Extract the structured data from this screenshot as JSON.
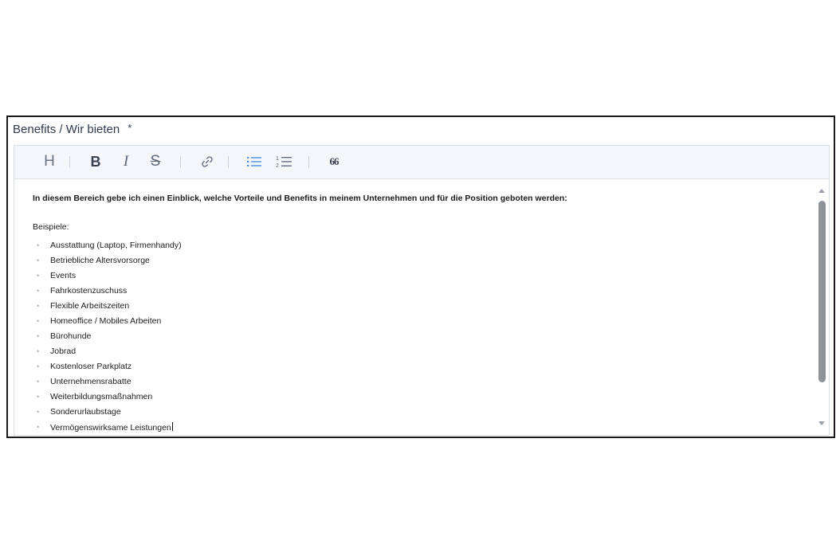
{
  "field": {
    "label": "Benefits / Wir bieten",
    "required_marker": "*"
  },
  "toolbar": {
    "heading": "H",
    "bold": "B",
    "italic": "I",
    "strikethrough": "S",
    "quote": "66",
    "icons": [
      "heading-icon",
      "bold-icon",
      "italic-icon",
      "strikethrough-icon",
      "link-icon",
      "bullet-list-icon",
      "numbered-list-icon",
      "quote-icon"
    ],
    "accent_color": "#4a8fe7"
  },
  "content": {
    "intro": "In diesem Bereich gebe ich einen Einblick, welche Vorteile und Benefits in meinem Unternehmen und für die Position geboten werden:",
    "examples_label": "Beispiele:",
    "items": [
      "Ausstattung (Laptop, Firmenhandy)",
      "Betriebliche Altersvorsorge",
      "Events",
      "Fahrkostenzuschuss",
      "Flexible Arbeitszeiten",
      "Homeoffice / Mobiles Arbeiten",
      "Bürohunde",
      "Jobrad",
      "Kostenloser Parkplatz",
      "Unternehmensrabatte",
      "Weiterbildungsmaßnahmen",
      "Sonderurlaubstage",
      "Vermögenswirksame Leistungen"
    ]
  }
}
